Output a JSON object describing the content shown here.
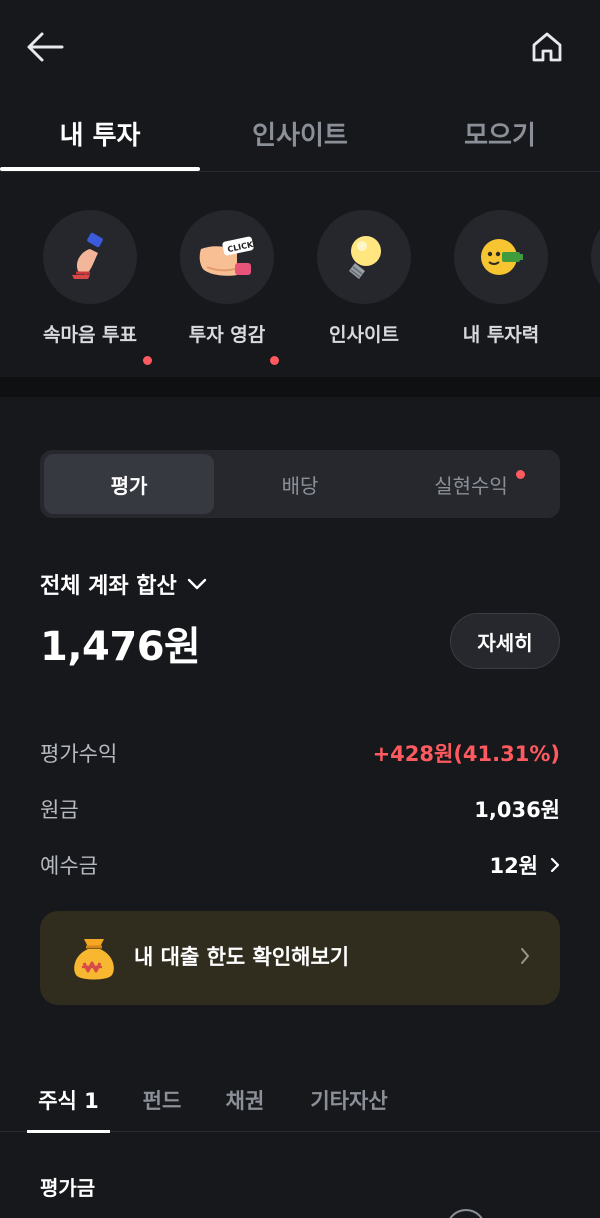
{
  "nav": {
    "back_icon": "arrow-left-icon",
    "home_icon": "home-icon"
  },
  "main_tabs": [
    {
      "label": "내 투자",
      "active": true
    },
    {
      "label": "인사이트",
      "active": false
    },
    {
      "label": "모으기",
      "active": false
    }
  ],
  "shortcuts": [
    {
      "label": "속마음 투표",
      "icon": "vote-stamp-icon",
      "new_dot": true
    },
    {
      "label": "투자 영감",
      "icon": "click-finger-icon",
      "new_dot": true
    },
    {
      "label": "인사이트",
      "icon": "lightbulb-icon",
      "new_dot": false
    },
    {
      "label": "내 투자력",
      "icon": "battery-face-icon",
      "new_dot": false
    }
  ],
  "segment": [
    {
      "label": "평가",
      "active": true
    },
    {
      "label": "배당",
      "active": false
    },
    {
      "label": "실현수익",
      "active": false,
      "new_dot": true
    }
  ],
  "account": {
    "title": "전체 계좌 합산",
    "total": "1,476원",
    "detail_button": "자세히"
  },
  "summary": [
    {
      "label": "평가수익",
      "value": "+428원(41.31%)",
      "color": "#ff5a5f"
    },
    {
      "label": "원금",
      "value": "1,036원"
    },
    {
      "label": "예수금",
      "value": "12원",
      "has_chevron": true
    }
  ],
  "banner": {
    "text": "내 대출 한도 확인해보기",
    "icon": "money-bag-icon"
  },
  "asset_tabs": [
    {
      "label": "주식 1",
      "active": true
    },
    {
      "label": "펀드",
      "active": false
    },
    {
      "label": "채권",
      "active": false
    },
    {
      "label": "기타자산",
      "active": false
    }
  ],
  "evaluation": {
    "label": "평가금"
  },
  "colors": {
    "background": "#17181c",
    "accent_red": "#ff5a5f",
    "card": "#26282d",
    "banner": "#302c1e"
  }
}
